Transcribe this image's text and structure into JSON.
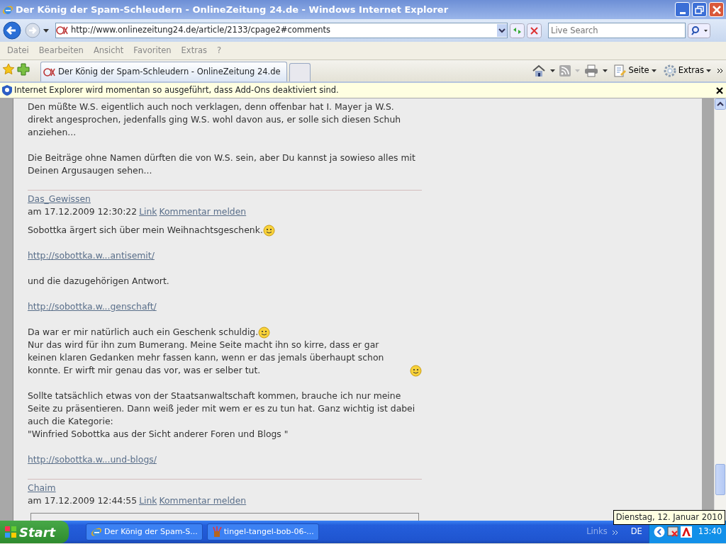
{
  "window": {
    "title": "Der König der Spam-Schleudern - OnlineZeitung 24.de - Windows Internet Explorer"
  },
  "address_bar": {
    "url": "http://www.onlinezeitung24.de/article/2133/cpage2#comments",
    "search_placeholder": "Live Search"
  },
  "menu": [
    "Datei",
    "Bearbeiten",
    "Ansicht",
    "Favoriten",
    "Extras",
    "?"
  ],
  "tabs": [
    {
      "label": "Der König der Spam-Schleudern - OnlineZeitung 24.de",
      "selected": true
    }
  ],
  "toolbar": [
    "Seite",
    "Extras"
  ],
  "info_bar": {
    "text": "Internet Explorer wird momentan so ausgeführt, dass Add-Ons deaktiviert sind."
  },
  "page": {
    "intro": [
      [
        {
          "kind": "text",
          "text": "Den müßte W.S. eigentlich auch noch verklagen, denn offenbar hat I. Mayer ja W.S. direkt angesprochen, jedenfalls ging W.S. wohl davon aus, er solle sich diesen Schuh anziehen..."
        }
      ],
      [
        {
          "kind": "text",
          "text": "Die Beiträge ohne Namen dürften die von W.S. sein, aber Du kannst ja sowieso alles mit Deinen Argusaugen sehen..."
        }
      ]
    ],
    "comments": [
      {
        "author": "Das_Gewissen",
        "date": "am 17.12.2009 12:30:22",
        "link": "Link",
        "report": "Kommentar melden",
        "body": [
          [
            {
              "kind": "text",
              "text": "Sobottka ärgert sich über mein Weihnachtsgeschenk.",
              "smiley": true
            }
          ],
          [
            {
              "kind": "link",
              "text": "http://sobottka.w...antisemit/"
            }
          ],
          [
            {
              "kind": "text",
              "text": "und die dazugehörigen Antwort."
            }
          ],
          [
            {
              "kind": "link",
              "text": "http://sobottka.w...genschaft/"
            }
          ],
          [
            {
              "kind": "text",
              "text": "Da war er mir natürlich auch ein Geschenk schuldig.",
              "smiley": true
            },
            {
              "kind": "text",
              "text": "Nur das wird für ihn zum Bumerang. Meine Seite macht ihn so kirre, dass er gar keinen klaren Gedanken mehr fassen kann, wenn er das jemals überhaupt schon konnte. Er wirft mir genau das vor, was er selber tut.",
              "smiley": true
            }
          ],
          [
            {
              "kind": "text",
              "text": "Sollte tatsächlich etwas von der Staatsanwaltschaft kommen, brauche ich nur meine Seite zu präsentieren. Dann weiß jeder mit wem er es zu tun hat. Ganz wichtig ist dabei auch die Kategorie:"
            },
            {
              "kind": "text",
              "text": "\"Winfried Sobottka aus der Sicht anderer Foren und Blogs \""
            }
          ],
          [
            {
              "kind": "link",
              "text": "http://sobottka.w...und-blogs/"
            }
          ]
        ]
      },
      {
        "author": "Chaim",
        "date": "am 17.12.2009 12:44:55",
        "link": "Link",
        "report": "Kommentar melden"
      }
    ]
  },
  "taskbar": {
    "start": "Start",
    "tasks": [
      {
        "label": "Der König der Spam-S...",
        "selected": false
      },
      {
        "label": "tingel-tangel-bob-06-...",
        "selected": false
      }
    ],
    "links": "Links",
    "language": "DE",
    "clock": "13:40",
    "tooltip": "Dienstag, 12. Januar 2010"
  }
}
